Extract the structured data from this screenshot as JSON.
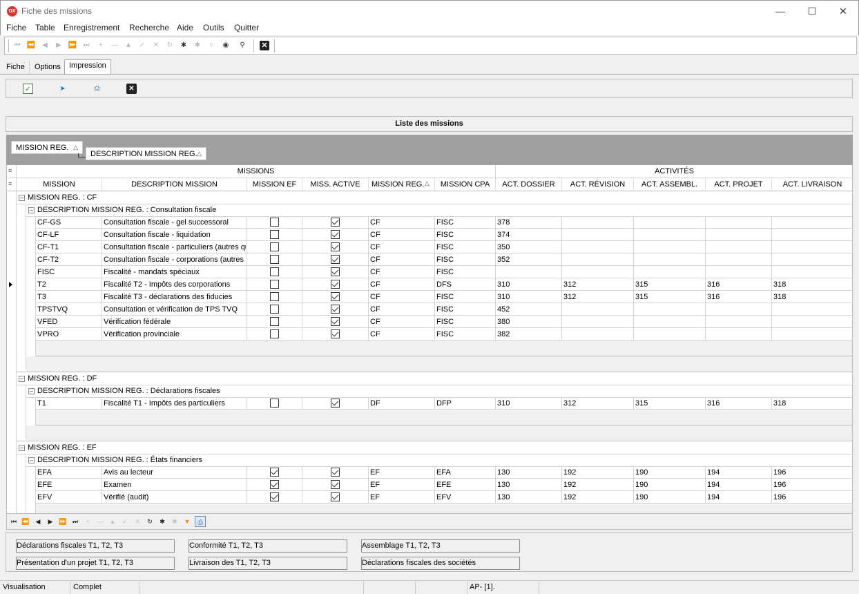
{
  "window": {
    "title": "Fiche des missions",
    "logo": "OX"
  },
  "menu": [
    "Fiche",
    "Table",
    "Enregistrement",
    "Recherche",
    "Aide",
    "Outils",
    "Quitter"
  ],
  "tabs": [
    "Fiche",
    "Options",
    "Impression"
  ],
  "active_tab": "Impression",
  "list_title": "Liste des missions",
  "group_chips": [
    "MISSION REG.",
    "DESCRIPTION MISSION REG."
  ],
  "grid": {
    "band_headers": {
      "missions": "MISSIONS",
      "activites": "ACTIVITÉS"
    },
    "columns": [
      "MISSION",
      "DESCRIPTION MISSION",
      "MISSION EF",
      "MISS. ACTIVE",
      "MISSION REG.",
      "MISSION CPA",
      "ACT. DOSSIER",
      "ACT. RÉVISION",
      "ACT. ASSEMBL.",
      "ACT. PROJET",
      "ACT. LIVRAISON"
    ],
    "group_level1_prefix": "MISSION REG. : ",
    "group_level2_prefix": "DESCRIPTION MISSION REG. : ",
    "groups": [
      {
        "reg": "CF",
        "description": "Consultation fiscale",
        "rows": [
          {
            "mission": "CF-GS",
            "desc": "Consultation fiscale - gel successoral",
            "ef": false,
            "active": true,
            "reg": "CF",
            "cpa": "FISC",
            "dossier": "378",
            "revision": "",
            "assembl": "",
            "projet": "",
            "livraison": ""
          },
          {
            "mission": "CF-LF",
            "desc": "Consultation fiscale - liquidation",
            "ef": false,
            "active": true,
            "reg": "CF",
            "cpa": "FISC",
            "dossier": "374",
            "revision": "",
            "assembl": "",
            "projet": "",
            "livraison": ""
          },
          {
            "mission": "CF-T1",
            "desc": "Consultation fiscale - particuliers (autres qu",
            "ef": false,
            "active": true,
            "reg": "CF",
            "cpa": "FISC",
            "dossier": "350",
            "revision": "",
            "assembl": "",
            "projet": "",
            "livraison": ""
          },
          {
            "mission": "CF-T2",
            "desc": "Consultation fiscale - corporations (autres q",
            "ef": false,
            "active": true,
            "reg": "CF",
            "cpa": "FISC",
            "dossier": "352",
            "revision": "",
            "assembl": "",
            "projet": "",
            "livraison": ""
          },
          {
            "mission": "FISC",
            "desc": "Fiscalité - mandats spéciaux",
            "ef": false,
            "active": true,
            "reg": "CF",
            "cpa": "FISC",
            "dossier": "",
            "revision": "",
            "assembl": "",
            "projet": "",
            "livraison": ""
          },
          {
            "mission": "T2",
            "desc": "Fiscalité T2 - Impôts des corporations",
            "ef": false,
            "active": true,
            "reg": "CF",
            "cpa": "DFS",
            "dossier": "310",
            "revision": "312",
            "assembl": "315",
            "projet": "316",
            "livraison": "318",
            "selected": true
          },
          {
            "mission": "T3",
            "desc": "Fiscalité T3 - déclarations des fiducies",
            "ef": false,
            "active": true,
            "reg": "CF",
            "cpa": "FISC",
            "dossier": "310",
            "revision": "312",
            "assembl": "315",
            "projet": "316",
            "livraison": "318"
          },
          {
            "mission": "TPSTVQ",
            "desc": "Consultation et vérification de TPS TVQ",
            "ef": false,
            "active": true,
            "reg": "CF",
            "cpa": "FISC",
            "dossier": "452",
            "revision": "",
            "assembl": "",
            "projet": "",
            "livraison": ""
          },
          {
            "mission": "VFED",
            "desc": "Vérification fédérale",
            "ef": false,
            "active": true,
            "reg": "CF",
            "cpa": "FISC",
            "dossier": "380",
            "revision": "",
            "assembl": "",
            "projet": "",
            "livraison": ""
          },
          {
            "mission": "VPRO",
            "desc": "Vérification provinciale",
            "ef": false,
            "active": true,
            "reg": "CF",
            "cpa": "FISC",
            "dossier": "382",
            "revision": "",
            "assembl": "",
            "projet": "",
            "livraison": ""
          }
        ]
      },
      {
        "reg": "DF",
        "description": "Déclarations fiscales",
        "rows": [
          {
            "mission": "T1",
            "desc": "Fiscalité T1 - Impôts des particuliers",
            "ef": false,
            "active": true,
            "reg": "DF",
            "cpa": "DFP",
            "dossier": "310",
            "revision": "312",
            "assembl": "315",
            "projet": "316",
            "livraison": "318"
          }
        ]
      },
      {
        "reg": "EF",
        "description": "États financiers",
        "rows": [
          {
            "mission": "EFA",
            "desc": "Avis au lecteur",
            "ef": true,
            "active": true,
            "reg": "EF",
            "cpa": "EFA",
            "dossier": "130",
            "revision": "192",
            "assembl": "190",
            "projet": "194",
            "livraison": "196"
          },
          {
            "mission": "EFE",
            "desc": "Examen",
            "ef": true,
            "active": true,
            "reg": "EF",
            "cpa": "EFE",
            "dossier": "130",
            "revision": "192",
            "assembl": "190",
            "projet": "194",
            "livraison": "196"
          },
          {
            "mission": "EFV",
            "desc": "Vérifié (audit)",
            "ef": true,
            "active": true,
            "reg": "EF",
            "cpa": "EFV",
            "dossier": "130",
            "revision": "192",
            "assembl": "190",
            "projet": "194",
            "livraison": "196"
          }
        ]
      }
    ]
  },
  "reports": [
    "Déclarations fiscales T1, T2, T3",
    "Conformité T1, T2, T3",
    "Assemblage T1, T2, T3",
    "Présentation d'un projet T1, T2, T3",
    "Livraison des T1, T2, T3",
    "Déclarations fiscales des sociétés"
  ],
  "status": {
    "mode": "Visualisation",
    "state": "Complet",
    "record": "AP- [1]."
  },
  "colors": {
    "accent_logo": "#d9352f",
    "group_band": "#a0a0a0",
    "orange_filter": "#f08a00"
  }
}
